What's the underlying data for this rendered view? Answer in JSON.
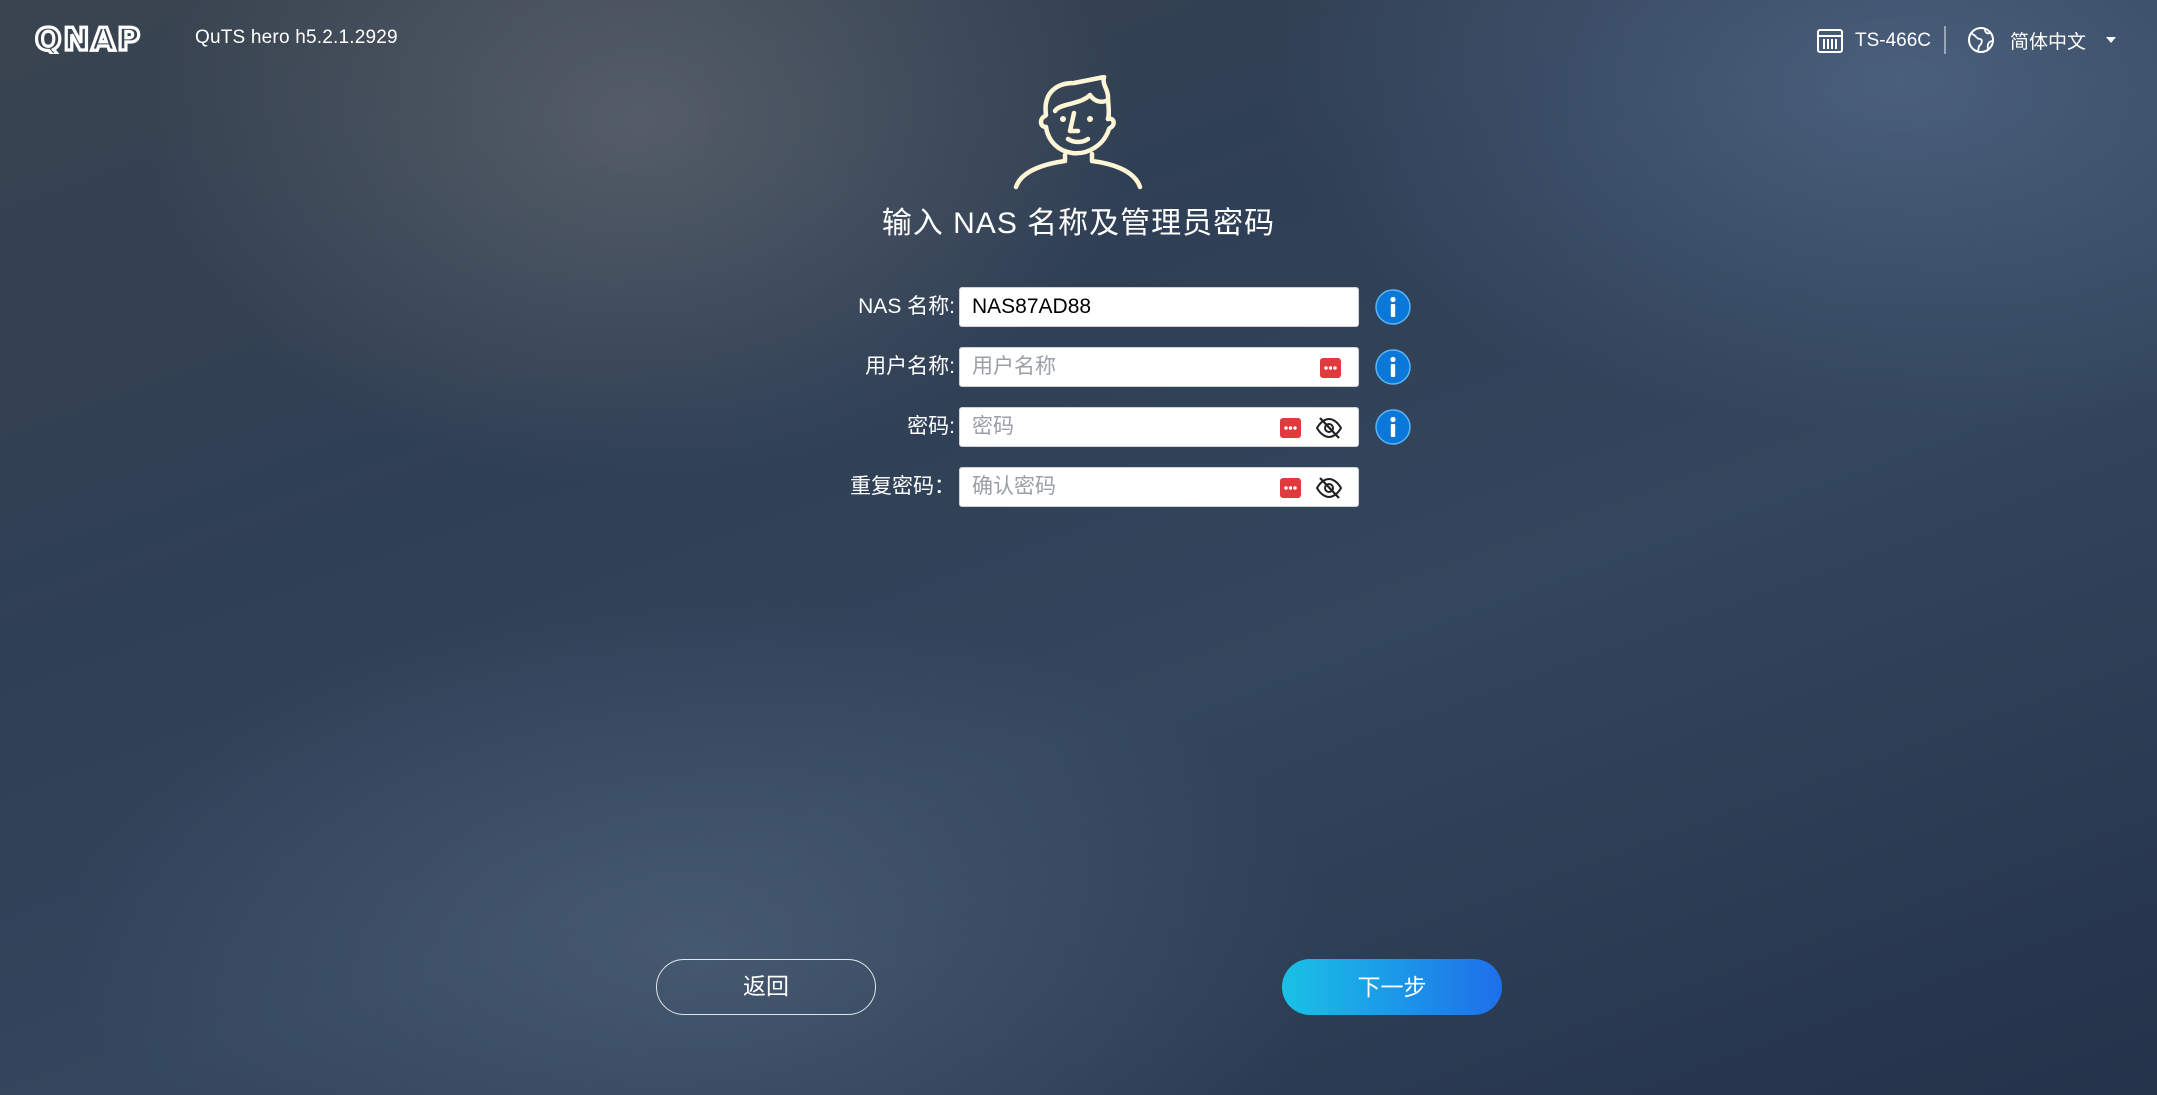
{
  "header": {
    "brand": "QNAP",
    "version": "QuTS hero h5.2.1.2929",
    "model": "TS-466C",
    "language": "简体中文"
  },
  "icons": {
    "logo": "qnap-logo",
    "model": "nas-device-icon",
    "language": "globe-icon",
    "avatar": "user-avatar-icon",
    "info": "info-icon",
    "keypass": "password-manager-icon",
    "eye": "eye-slash-icon"
  },
  "page": {
    "title": "输入 NAS 名称及管理员密码"
  },
  "form": {
    "nas_name": {
      "label": "NAS 名称:",
      "value": "NAS87AD88",
      "placeholder": ""
    },
    "username": {
      "label": "用户名称:",
      "value": "",
      "placeholder": "用户名称"
    },
    "password": {
      "label": "密码:",
      "value": "",
      "placeholder": "密码"
    },
    "confirm_password": {
      "label": "重复密码：",
      "value": "",
      "placeholder": "确认密码"
    }
  },
  "buttons": {
    "back": "返回",
    "next": "下一步"
  },
  "colors": {
    "accent_start": "#19c2e6",
    "accent_end": "#1e6fea",
    "info_blue": "#0a78d8",
    "keypass_red": "#e0393e",
    "avatar_cream": "#fff6d6"
  }
}
